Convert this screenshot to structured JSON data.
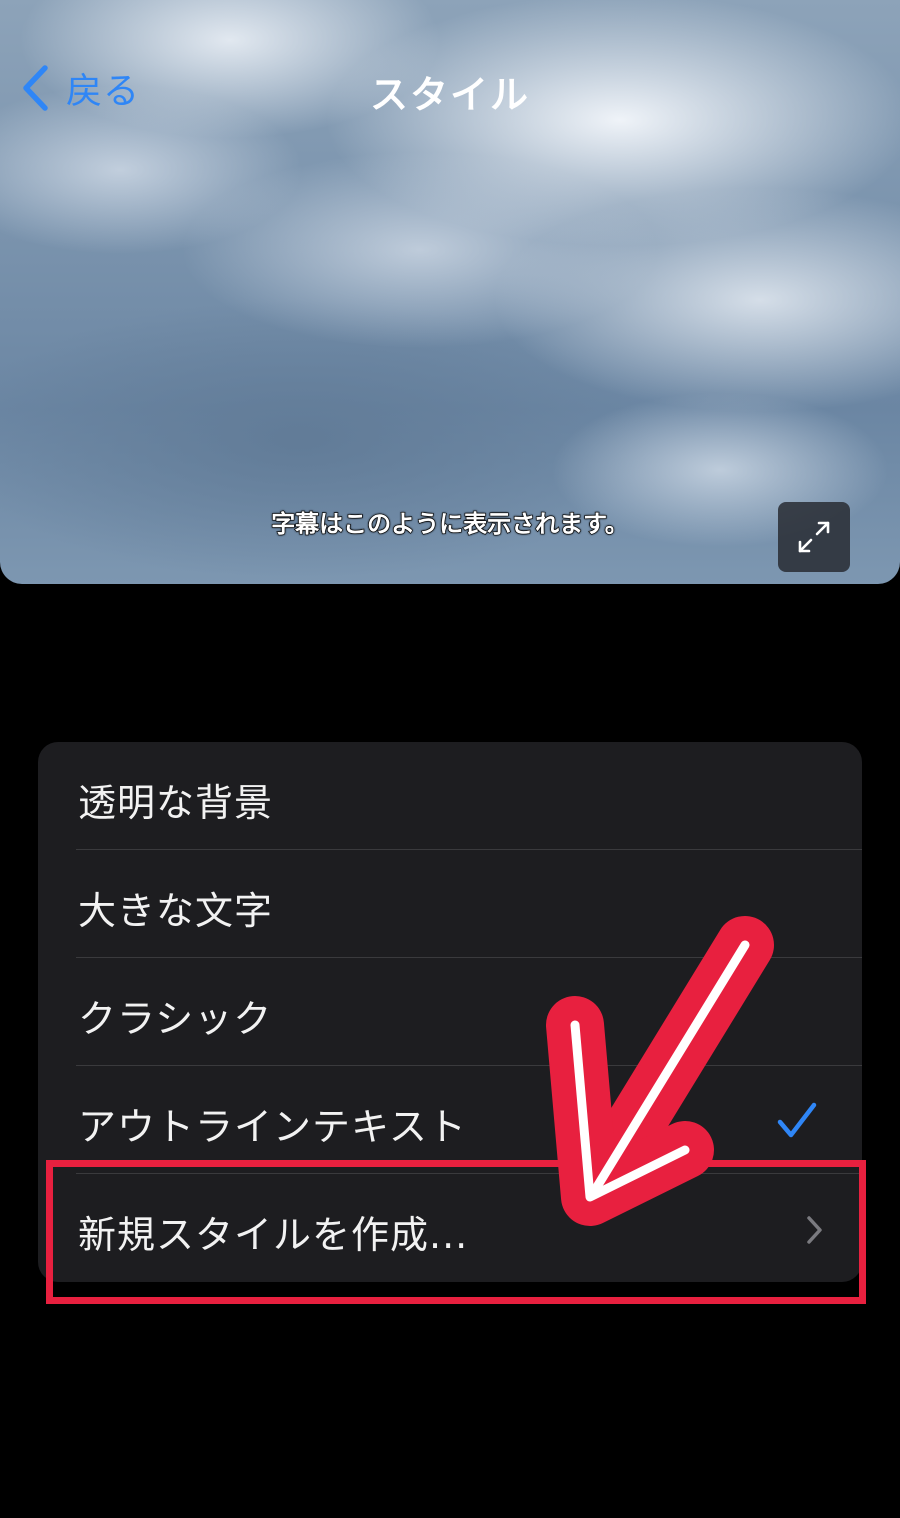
{
  "nav": {
    "back_label": "戻る",
    "title": "スタイル"
  },
  "preview": {
    "caption_sample": "字幕はこのように表示されます。"
  },
  "styles": {
    "items": [
      {
        "label": "透明な背景",
        "selected": false
      },
      {
        "label": "大きな文字",
        "selected": false
      },
      {
        "label": "クラシック",
        "selected": false
      },
      {
        "label": "アウトラインテキスト",
        "selected": true
      }
    ],
    "create_new_label": "新規スタイルを作成..."
  },
  "colors": {
    "accent": "#2f86f6",
    "annotation": "#e8203f",
    "list_background": "#1d1d20",
    "page_background": "#000000"
  },
  "icons": {
    "back": "chevron-left-icon",
    "expand": "expand-arrows-icon",
    "selected": "checkmark-icon",
    "disclosure": "chevron-right-icon"
  }
}
